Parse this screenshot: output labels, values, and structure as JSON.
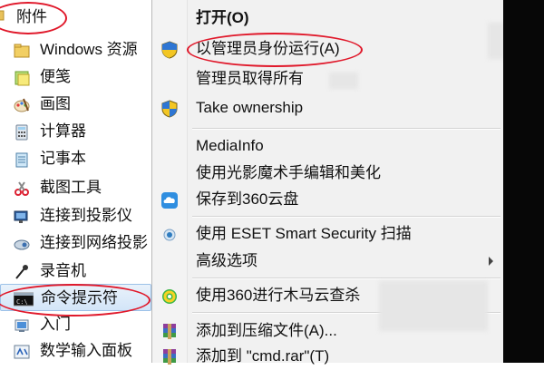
{
  "start_menu": {
    "items": [
      {
        "label": "附件",
        "icon": "folder-icon"
      },
      {
        "label": "Windows 资源",
        "icon": "windows-explorer-icon"
      },
      {
        "label": "便笺",
        "icon": "sticky-notes-icon"
      },
      {
        "label": "画图",
        "icon": "paint-icon"
      },
      {
        "label": "计算器",
        "icon": "calculator-icon"
      },
      {
        "label": "记事本",
        "icon": "notepad-icon"
      },
      {
        "label": "截图工具",
        "icon": "snipping-tool-icon"
      },
      {
        "label": "连接到投影仪",
        "icon": "projector-icon"
      },
      {
        "label": "连接到网络投影",
        "icon": "network-projector-icon"
      },
      {
        "label": "录音机",
        "icon": "microphone-icon"
      },
      {
        "label": "命令提示符",
        "icon": "command-prompt-icon"
      },
      {
        "label": "入门",
        "icon": "getting-started-icon"
      },
      {
        "label": "数学输入面板",
        "icon": "math-input-icon"
      }
    ]
  },
  "context_menu": {
    "items": [
      {
        "label": "打开(O)",
        "icon": "",
        "bold": true
      },
      {
        "label": "以管理员身份运行(A)",
        "icon": "uac-shield-icon"
      },
      {
        "label": "管理员取得所有",
        "icon": ""
      },
      {
        "label": "Take ownership",
        "icon": "uac-shield-icon"
      },
      {
        "label": "MediaInfo",
        "icon": ""
      },
      {
        "label": "使用光影魔术手编辑和美化",
        "icon": ""
      },
      {
        "label": "保存到360云盘",
        "icon": "cloud-360-icon"
      },
      {
        "label": "使用 ESET Smart Security 扫描",
        "icon": "eset-icon"
      },
      {
        "label": "高级选项",
        "icon": ""
      },
      {
        "label": "使用360进行木马云查杀",
        "icon": "360-security-icon"
      },
      {
        "label": "添加到压缩文件(A)...",
        "icon": "winrar-icon"
      },
      {
        "label": "添加到 \"cmd.rar\"(T)",
        "icon": "winrar-icon"
      }
    ]
  },
  "colors": {
    "highlight_oval": "#e0182a",
    "menu_background": "#f1f1f1",
    "selection": "#d3e5f8"
  }
}
